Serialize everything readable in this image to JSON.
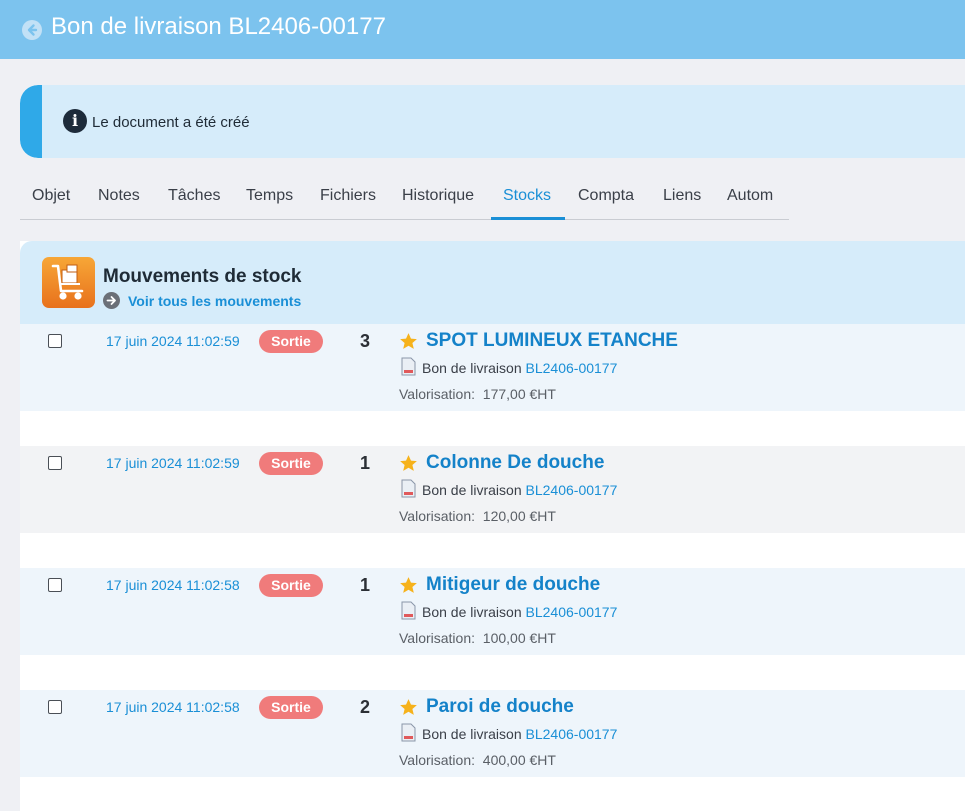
{
  "header": {
    "back_icon": "back-arrow-circle-icon",
    "title": "Bon de livraison BL2406-00177"
  },
  "notice": {
    "icon": "info-icon",
    "text": "Le document a été créé"
  },
  "tabs": [
    {
      "label": "Objet"
    },
    {
      "label": "Notes"
    },
    {
      "label": "Tâches"
    },
    {
      "label": "Temps"
    },
    {
      "label": "Fichiers"
    },
    {
      "label": "Historique"
    },
    {
      "label": "Stocks",
      "active": true
    },
    {
      "label": "Compta"
    },
    {
      "label": "Liens"
    },
    {
      "label": "Autom"
    }
  ],
  "panel": {
    "icon": "hand-truck-icon",
    "title": "Mouvements de stock",
    "link": "Voir tous les mouvements"
  },
  "movements": [
    {
      "date": "17 juin 2024 11:02:59",
      "type": "Sortie",
      "qty": "3",
      "product": "SPOT LUMINEUX ETANCHE",
      "doc_label": "Bon de livraison",
      "doc_ref": "BL2406-00177",
      "valo_label": "Valorisation:",
      "valo_value": "177,00 €HT"
    },
    {
      "date": "17 juin 2024 11:02:59",
      "type": "Sortie",
      "qty": "1",
      "product": "Colonne De douche",
      "doc_label": "Bon de livraison",
      "doc_ref": "BL2406-00177",
      "valo_label": "Valorisation:",
      "valo_value": "120,00 €HT"
    },
    {
      "date": "17 juin 2024 11:02:58",
      "type": "Sortie",
      "qty": "1",
      "product": "Mitigeur de douche",
      "doc_label": "Bon de livraison",
      "doc_ref": "BL2406-00177",
      "valo_label": "Valorisation:",
      "valo_value": "100,00 €HT"
    },
    {
      "date": "17 juin 2024 11:02:58",
      "type": "Sortie",
      "qty": "2",
      "product": "Paroi de douche",
      "doc_label": "Bon de livraison",
      "doc_ref": "BL2406-00177",
      "valo_label": "Valorisation:",
      "valo_value": "400,00 €HT"
    }
  ],
  "colors": {
    "header_bg": "#7cc3ee",
    "accent": "#1a8fd6",
    "badge_sortie": "#f07b7b",
    "star": "#f6b21b"
  }
}
